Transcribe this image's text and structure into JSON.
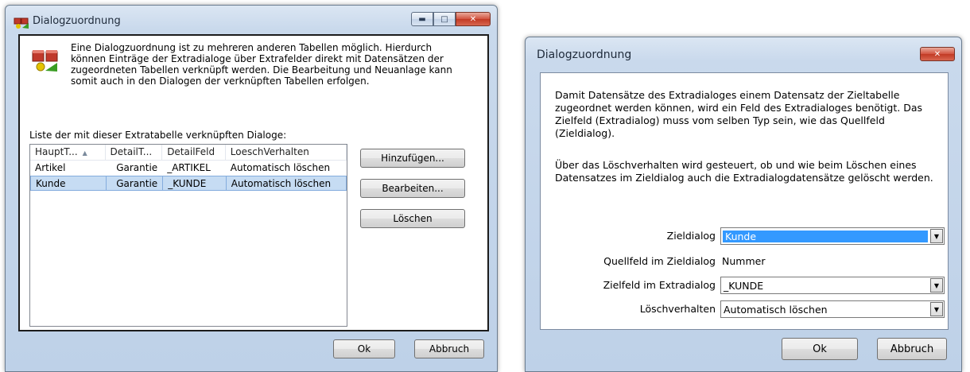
{
  "dialog1": {
    "title": "Dialogzuordnung",
    "info_text": "Eine Dialogzuordnung ist zu mehreren anderen Tabellen möglich. Hierdurch können Einträge der Extradialoge über Extrafelder direkt mit Datensätzen der zugeordneten Tabellen verknüpft werden. Die Bearbeitung und Neuanlage kann somit auch in den Dialogen der verknüpften Tabellen erfolgen.",
    "list_label": "Liste der mit dieser Extratabelle verknüpften Dialoge:",
    "columns": [
      "HauptT...",
      "DetailT...",
      "DetailFeld",
      "LoeschVerhalten"
    ],
    "rows": [
      [
        "Artikel",
        "Garantie",
        "_ARTIKEL",
        "Automatisch löschen"
      ],
      [
        "Kunde",
        "Garantie",
        "_KUNDE",
        "Automatisch löschen"
      ]
    ],
    "selected_row": 1,
    "buttons": {
      "add": "Hinzufügen...",
      "edit": "Bearbeiten...",
      "delete": "Löschen"
    },
    "ok": "Ok",
    "cancel": "Abbruch"
  },
  "dialog2": {
    "title": "Dialogzuordnung",
    "paragraph1": "Damit Datensätze des Extradialoges einem Datensatz der Zieltabelle zugeordnet werden können, wird ein Feld des Extradialoges benötigt. Das Zielfeld (Extradialog) muss vom selben Typ sein, wie das Quellfeld (Zieldialog).",
    "paragraph2": "Über das Löschverhalten wird gesteuert, ob und wie beim Löschen eines Datensatzes im Zieldialog auch die Extradialogdatensätze gelöscht werden.",
    "fields": {
      "zieldialog_label": "Zieldialog",
      "zieldialog_value": "Kunde",
      "quellfeld_label": "Quellfeld im Zieldialog",
      "quellfeld_value": "Nummer",
      "zielfeld_label": "Zielfeld im Extradialog",
      "zielfeld_value": "_KUNDE",
      "loesch_label": "Löschverhalten",
      "loesch_value": "Automatisch löschen"
    },
    "ok": "Ok",
    "cancel": "Abbruch"
  },
  "icons": {
    "minimize": "minimize-icon",
    "maximize": "maximize-icon",
    "close": "close-icon",
    "dropdown": "chevron-down-icon"
  },
  "colors": {
    "selection": "#c6dcf3",
    "highlight": "#3399ff",
    "close_button": "#c13a24"
  }
}
